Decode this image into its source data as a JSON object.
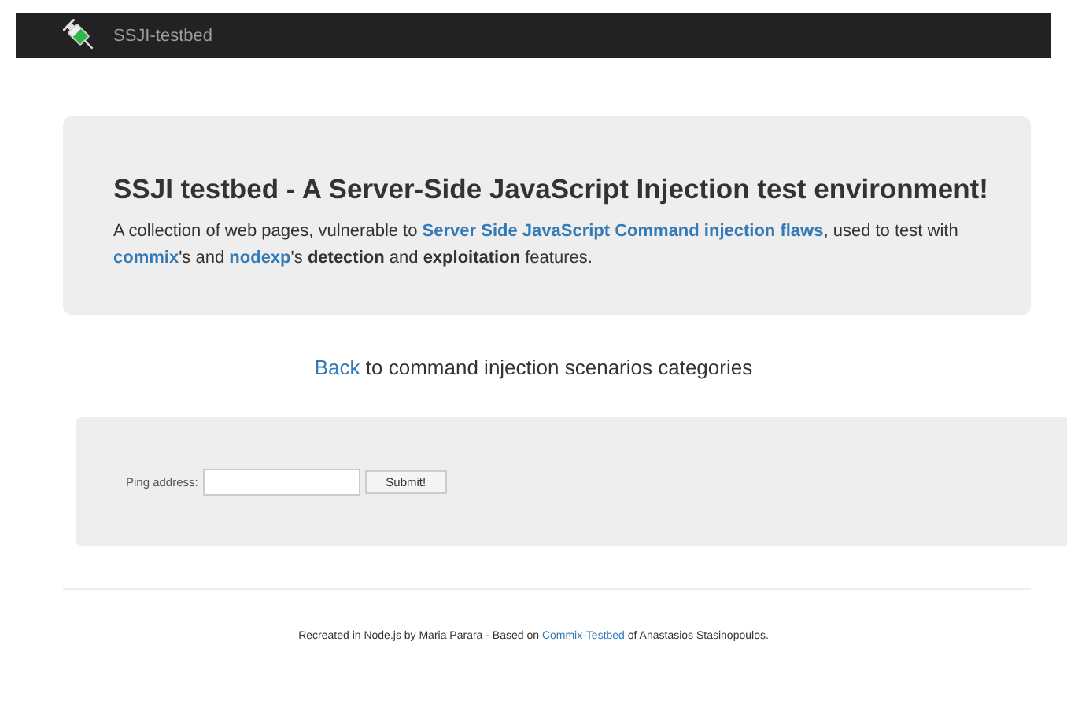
{
  "navbar": {
    "brand": "SSJI-testbed"
  },
  "jumbotron": {
    "title": "SSJI testbed - A Server-Side JavaScript Injection test environment!",
    "description": [
      {
        "kind": "text",
        "text": "A collection of web pages, vulnerable to "
      },
      {
        "kind": "link",
        "text": "Server Side JavaScript Command injection flaws"
      },
      {
        "kind": "text",
        "text": ", used to test with "
      },
      {
        "kind": "link",
        "text": "commix"
      },
      {
        "kind": "text",
        "text": "'s and "
      },
      {
        "kind": "link",
        "text": "nodexp"
      },
      {
        "kind": "text",
        "text": "'s "
      },
      {
        "kind": "bold",
        "text": "detection"
      },
      {
        "kind": "text",
        "text": " and "
      },
      {
        "kind": "bold",
        "text": "exploitation"
      },
      {
        "kind": "text",
        "text": " features."
      }
    ]
  },
  "back": {
    "link": "Back",
    "text": " to command injection scenarios categories"
  },
  "form": {
    "label": "Ping address:",
    "button": "Submit!"
  },
  "footer": [
    {
      "kind": "text",
      "text": "Recreated in Node.js by Maria Parara - Based on "
    },
    {
      "kind": "link",
      "text": "Commix-Testbed"
    },
    {
      "kind": "text",
      "text": " of Anastasios Stasinopoulos."
    }
  ]
}
